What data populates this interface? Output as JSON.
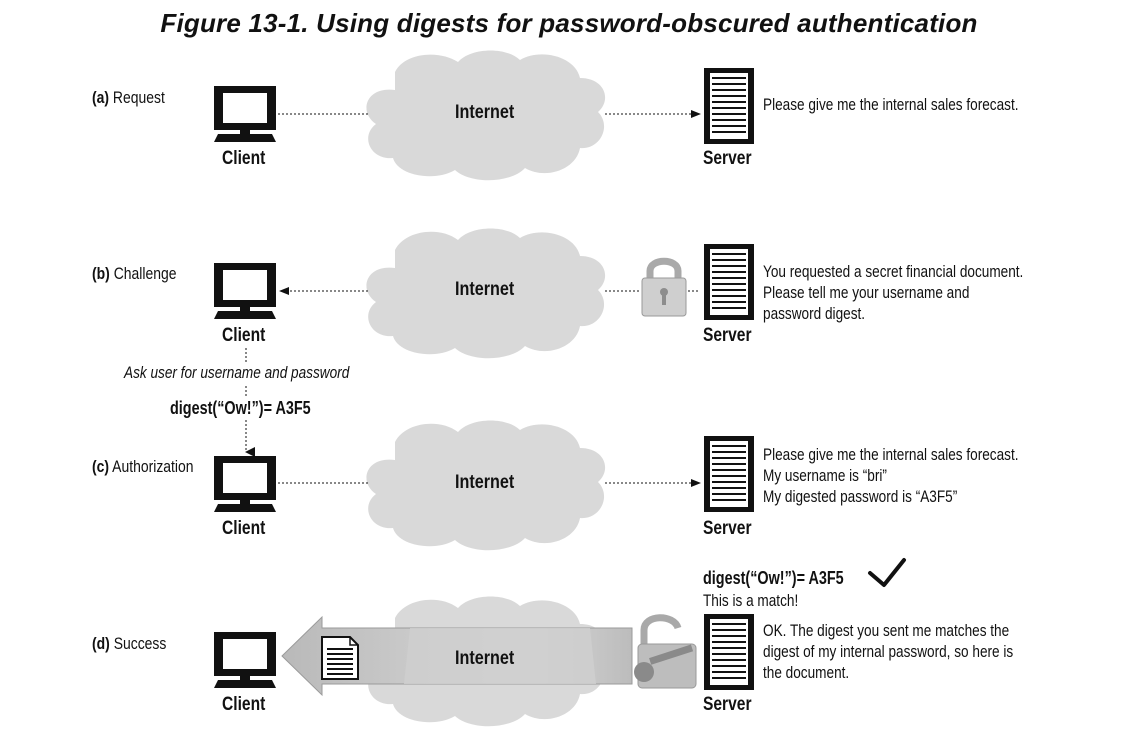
{
  "title": "Figure 13-1. Using digests for password-obscured authentication",
  "rows": [
    {
      "letter": "(a)",
      "name": "Request",
      "client": "Client",
      "server": "Server",
      "internet": "Internet",
      "message": "Please give me the internal sales forecast."
    },
    {
      "letter": "(b)",
      "name": "Challenge",
      "client": "Client",
      "server": "Server",
      "internet": "Internet",
      "message": "You requested a secret financial document.\nPlease tell me your username and\npassword digest."
    },
    {
      "letter": "(c)",
      "name": "Authorization",
      "client": "Client",
      "server": "Server",
      "internet": "Internet",
      "message": "Please give me the internal sales forecast.\nMy username is “bri”\nMy digested password is “A3F5”"
    },
    {
      "letter": "(d)",
      "name": "Success",
      "client": "Client",
      "server": "Server",
      "internet": "Internet",
      "message": "OK. The digest you sent me matches the\ndigest of my internal password, so here is\nthe document."
    }
  ],
  "client_step": {
    "ask": "Ask user for username and  password",
    "digest": "digest(“Ow!”)= A3F5"
  },
  "server_step": {
    "digest": "digest(“Ow!”)= A3F5",
    "match": "This is a match!"
  },
  "icons": {
    "client": "computer-monitor-icon",
    "server": "server-tower-icon",
    "cloud": "internet-cloud-icon",
    "locked": "locked-padlock-icon",
    "unlocked": "unlocked-padlock-icon",
    "key": "key-icon",
    "document": "document-icon",
    "check": "checkmark-icon"
  },
  "colors": {
    "ink": "#111111",
    "cloud": "#d9d9d9",
    "arrow": "#c8c8c8"
  }
}
